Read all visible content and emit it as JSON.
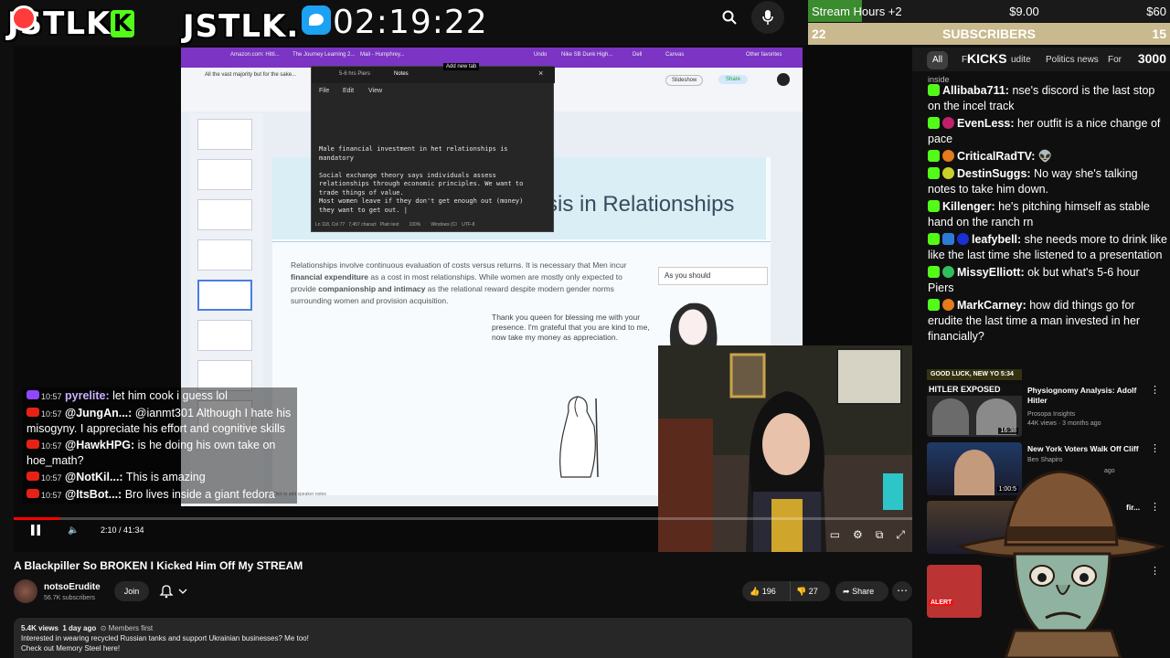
{
  "overlay": {
    "logo1": "JSTLK",
    "logo1_badge": "K",
    "logo2": "JSTLK.",
    "clock": "02:19:22"
  },
  "stats": {
    "stream_hours_label": "Stream Hours +2",
    "stream_hours_amount": "$9.00",
    "stream_hours_goal": "$60",
    "stream_hours_progress": 0.15,
    "subs_left": "22",
    "subs_label": "SUBSCRIBERS",
    "subs_right": "15",
    "kick_badge": "1",
    "kicks_label": "KICKS",
    "kicks_value": "3000",
    "chips": [
      "All",
      "Fr",
      "udite",
      "Politics news",
      "For"
    ]
  },
  "kick_chat": [
    {
      "user": "",
      "text": "inside"
    },
    {
      "user": "Allibaba711:",
      "text": "nse's discord is the last stop on the incel track",
      "color": "#f1f1f1"
    },
    {
      "user": "EvenLess:",
      "text": "her outfit is a nice change of pace",
      "color": "#f1f1f1"
    },
    {
      "user": "CriticalRadTV:",
      "text": "👽",
      "color": "#f1f1f1"
    },
    {
      "user": "DestinSuggs:",
      "text": "No way she's talking notes to take him down.",
      "color": "#f1f1f1"
    },
    {
      "user": "Killenger:",
      "text": "he's pitching himself as stable hand on the ranch rn",
      "color": "#f1f1f1"
    },
    {
      "user": "leafybell:",
      "text": "she needs more to drink like like the last time she listened to a presentation",
      "color": "#f1f1f1"
    },
    {
      "user": "MissyElliott:",
      "text": "ok but what's 5-6 hour Piers",
      "color": "#f1f1f1"
    },
    {
      "user": "MarkCarney:",
      "text": "how did things go for erudite the last time a man invested in her financially?",
      "color": "#f1f1f1"
    }
  ],
  "screen": {
    "tabs": [
      "Amazon.com: Hitti...",
      "The Journey Learning 2...",
      "Mail - Humphrey...",
      "Add new tab",
      "Undo",
      "Nike SB Dunk High...",
      "Dell",
      "Canvas",
      "Other favorites"
    ],
    "doc_title": "All the vast majority but for the sake...",
    "notepad": {
      "tab_label": "5-6 hrs Piers",
      "tab_notes": "Notes",
      "menu": [
        "File",
        "Edit",
        "View"
      ],
      "text": "Male financial investment in het relationships is\nmandatory\n\nSocial exchange theory says individuals assess\nrelationships through economic principles. We want to\ntrade things of value.\nMost women leave if they don't get enough out (money)\nthey want to get out. |",
      "status": "Ln 118, Col 77   7,457 charact   Plain text        100%        Windows (CI    UTF-8"
    },
    "slide_title": "sis in Relationships",
    "slide_body_1": "Relationships involve continuous evaluation of costs versus returns.  It is necessary that Men incur ",
    "slide_body_bold1": "financial expenditure",
    "slide_body_2": " as a cost in most relationships. While women are mostly only expected to provide ",
    "slide_body_bold2": "companionship and intimacy",
    "slide_body_3": " as the relational reward despite modern gender norms surrounding women and provision acquisition.",
    "slide_quote": "Thank you queen for blessing me with your presence. I'm grateful that you are kind to me, now take my money as appreciation.",
    "as_you_should": "As you should",
    "speaker_notes": "Click to add speaker notes",
    "slideshow": "Slideshow",
    "share": "Share"
  },
  "yt_chat": [
    {
      "time": "10:57",
      "user": "pyrelite:",
      "text": "let him cook i guess lol"
    },
    {
      "time": "10:57",
      "user": "@JungAn...:",
      "text": "@ianmt301 Although I hate his misogyny. I appreciate his effort and cognitive skills"
    },
    {
      "time": "10:57",
      "user": "@HawkHPG:",
      "text": "is he doing his own take on hoe_math?"
    },
    {
      "time": "10:57",
      "user": "@NotKil...:",
      "text": "This is amazing"
    },
    {
      "time": "10:57",
      "user": "@ItsBot...:",
      "text": "Bro lives inside a giant fedora"
    }
  ],
  "player": {
    "timecode": "2:10 / 41:34",
    "progress": 0.052
  },
  "video": {
    "title": "A Blackpiller So BROKEN I Kicked Him Off My STREAM",
    "channel": "notsoErudite",
    "subs": "56.7K subscribers",
    "join": "Join",
    "likes": "196",
    "dislikes": "27",
    "share": "Share",
    "views": "5.4K views",
    "age": "1 day ago",
    "members": "Members first",
    "desc1": "Interested in wearing recycled Russian tanks and support Ukrainian businesses? Me too!",
    "desc2": "Check out Memory Steel here!"
  },
  "recs": [
    {
      "badge": "HITLER EXPOSED",
      "title": "Physiognomy Analysis: Adolf Hitler",
      "channel": "Prosopa Insights",
      "meta": "44K views · 3 months ago",
      "duration": "16:38"
    },
    {
      "title": "New York Voters Walk Off Cliff",
      "channel": "Ben Shapiro",
      "meta": "ago",
      "duration": "1:00:5"
    },
    {
      "title": "fir...",
      "channel": "",
      "meta": "",
      "duration": ""
    },
    {
      "badge": "ALERT",
      "title": "",
      "channel": "",
      "meta": "",
      "duration": ""
    }
  ],
  "good_luck": "GOOD LUCK, NEW YO",
  "good_luck_time": "5:34"
}
